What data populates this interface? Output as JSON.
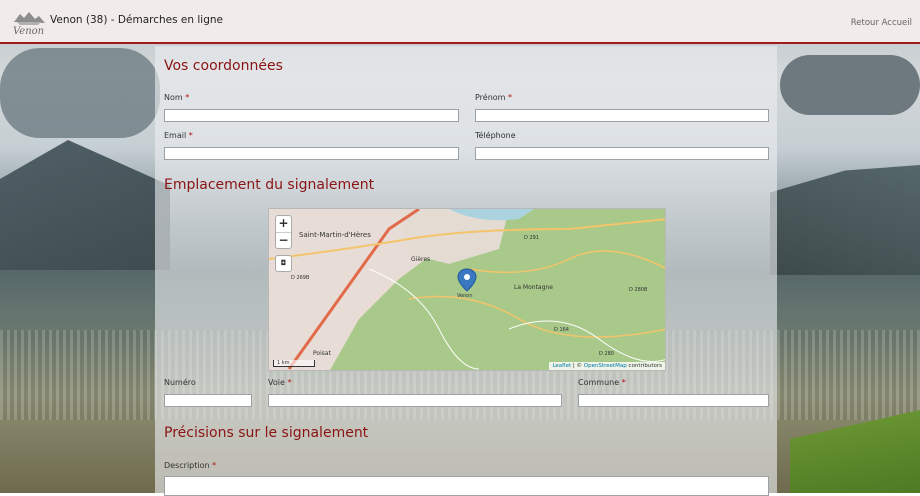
{
  "header": {
    "app_title": "Venon (38) - Démarches en ligne",
    "logo_text": "Venon",
    "back_link": "Retour Accueil"
  },
  "sections": {
    "contact": "Vos coordonnées",
    "location": "Emplacement du signalement",
    "details": "Précisions sur le signalement"
  },
  "fields": {
    "nom": {
      "label": "Nom",
      "required": "*",
      "value": ""
    },
    "prenom": {
      "label": "Prénom",
      "required": "*",
      "value": ""
    },
    "email": {
      "label": "Email",
      "required": "*",
      "value": ""
    },
    "telephone": {
      "label": "Téléphone",
      "value": ""
    },
    "numero": {
      "label": "Numéro",
      "value": ""
    },
    "voie": {
      "label": "Voie",
      "required": "*",
      "value": ""
    },
    "commune": {
      "label": "Commune",
      "required": "*",
      "value": ""
    },
    "description": {
      "label": "Description",
      "required": "*",
      "value": ""
    }
  },
  "map": {
    "zoom_in": "+",
    "zoom_out": "−",
    "locate": "◘",
    "attribution_leaflet": "Leaflet",
    "attribution_sep": " | © ",
    "attribution_osm": "OpenStreetMap",
    "attribution_tail": " contributors",
    "scale": "1 km",
    "marker_label": "Venon",
    "labels": [
      "Saint-Martin-d'Hères",
      "Gières",
      "La Montagne",
      "Poisat",
      "D 291",
      "D 280B",
      "D 164",
      "D 280",
      "D 269B"
    ],
    "colors": {
      "marker": "#3a78c2",
      "forest": "#a8c98a",
      "urban": "#e8ddd6",
      "road": "#f3c46b"
    }
  },
  "colors": {
    "accent": "#8a1414",
    "header_border": "#a01c1c"
  }
}
